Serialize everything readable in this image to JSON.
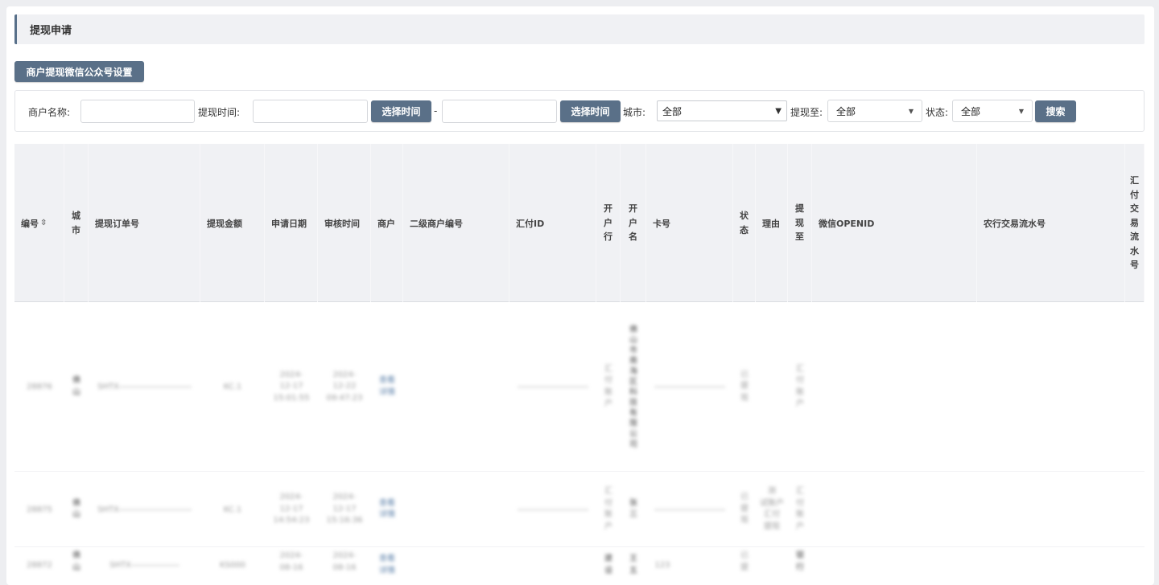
{
  "title": "提现申请",
  "wx_button": "商户提现微信公众号设置",
  "filter": {
    "merchant_label": "商户名称:",
    "time_label": "提现时间:",
    "pick_time": "选择时间",
    "range_sep": "-",
    "city_label": "城市:",
    "city_value": "全部",
    "withdraw_to_label": "提现至:",
    "withdraw_to_value": "全部",
    "status_label": "状态:",
    "status_value": "全部",
    "search": "搜索"
  },
  "columns": {
    "id": "编号",
    "city": [
      "城",
      "市"
    ],
    "order_no": "提现订单号",
    "amount": "提现金额",
    "apply_date": "申请日期",
    "audit_time": "审核时间",
    "merchant": "商户",
    "sub_merchant_no": "二级商户编号",
    "huifu_id": "汇付ID",
    "bank": [
      "开",
      "户",
      "行"
    ],
    "account_name": [
      "开",
      "户",
      "名"
    ],
    "card_no": "卡号",
    "status": [
      "状",
      "态"
    ],
    "reason": "理由",
    "withdraw_to": [
      "提",
      "现",
      "至"
    ],
    "wx_openid": "微信OPENID",
    "abc_serial": "农行交易流水号",
    "huifu_serial": [
      "汇",
      "付",
      "交",
      "易",
      "流",
      "水",
      "号"
    ]
  },
  "rows": [
    {
      "id": "28876",
      "city": [
        "佛",
        "山"
      ],
      "order_no": "SHTX",
      "amount": "KC.1",
      "apply_date": [
        "2024-",
        "12-17",
        "15:01:55"
      ],
      "audit_time": [
        "2024-",
        "12-22",
        "09:47:23"
      ],
      "merchant": [
        "查看",
        "详情"
      ],
      "bank": [
        "汇",
        "付",
        "账",
        "户"
      ],
      "account_name": [
        "佛",
        "山",
        "市",
        "南",
        "海",
        "区",
        "科",
        "技",
        "有",
        "限",
        "公",
        "司"
      ],
      "status": [
        "已",
        "提",
        "现"
      ],
      "withdraw_to": [
        "汇",
        "付",
        "账",
        "户"
      ]
    },
    {
      "id": "28875",
      "city": [
        "佛",
        "山"
      ],
      "order_no": "SHTX",
      "amount": "KC.1",
      "apply_date": [
        "2024-",
        "12-17",
        "14:54:23"
      ],
      "audit_time": [
        "2024-",
        "12-17",
        "15:16:36"
      ],
      "merchant": [
        "查看",
        "详情"
      ],
      "bank": [
        "汇",
        "付",
        "账",
        "户"
      ],
      "account_name": [
        "张",
        "三"
      ],
      "status": [
        "已",
        "提",
        "现"
      ],
      "reason": [
        "测",
        "试账户",
        "汇付",
        "提现"
      ],
      "withdraw_to": [
        "汇",
        "付",
        "账",
        "户"
      ]
    },
    {
      "id": "28872",
      "city": [
        "佛",
        "山"
      ],
      "order_no": "SHTX",
      "amount": "KS000",
      "apply_date": [
        "2024-",
        "08-16"
      ],
      "audit_time": [
        "2024-",
        "08-16"
      ],
      "merchant": [
        "查看",
        "详情"
      ],
      "bank": [
        "建",
        "设"
      ],
      "account_name": [
        "王",
        "五"
      ],
      "card_no": "123",
      "status": [
        "已",
        "提"
      ],
      "withdraw_to": [
        "银",
        "行"
      ]
    }
  ]
}
